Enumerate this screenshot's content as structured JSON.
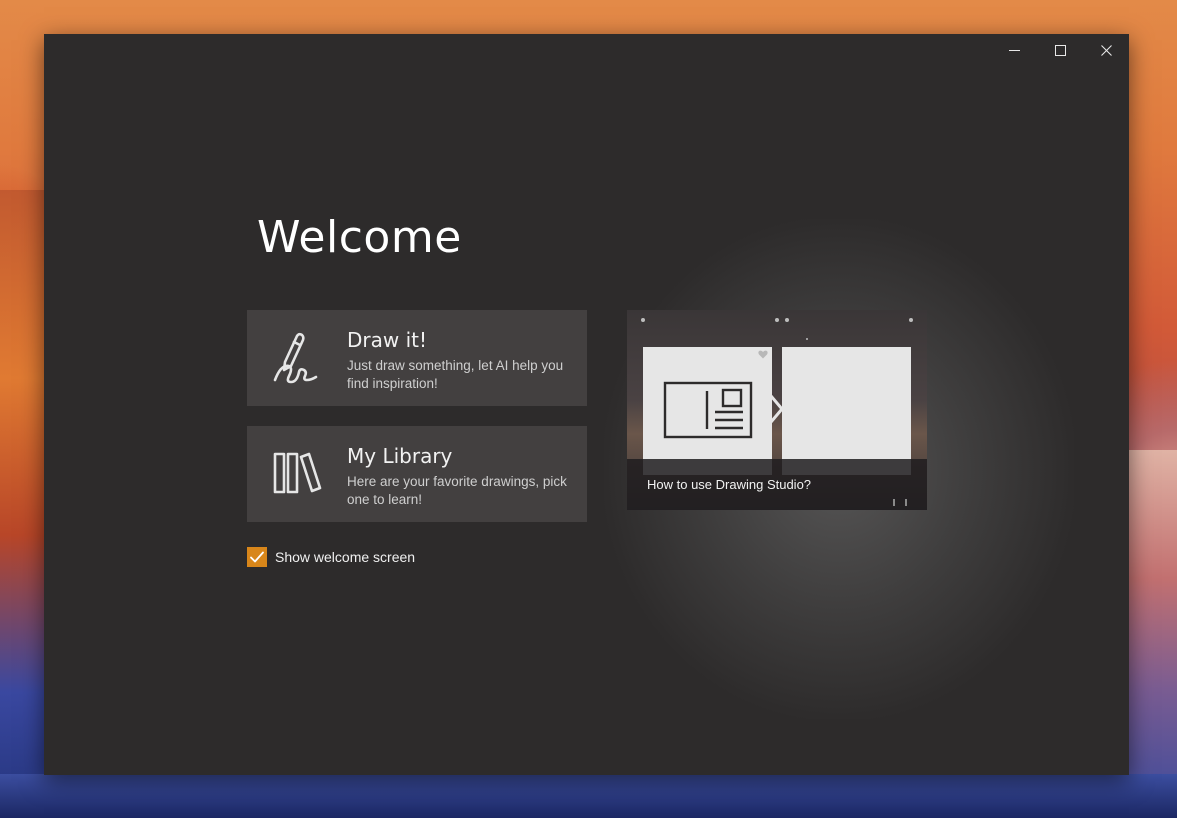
{
  "window": {
    "caption_buttons": {
      "minimize_icon": "minimize-icon",
      "maximize_icon": "maximize-icon",
      "close_icon": "close-icon"
    }
  },
  "welcome": {
    "title": "Welcome"
  },
  "tiles": [
    {
      "title": "Draw it!",
      "description": "Just draw something, let AI help you find inspiration!",
      "icon": "pen-scribble-icon"
    },
    {
      "title": "My Library",
      "description": "Here are your favorite drawings, pick one to learn!",
      "icon": "library-books-icon"
    }
  ],
  "show_welcome": {
    "label": "Show welcome screen",
    "checked": true,
    "accent": "#d8861a"
  },
  "video_card": {
    "caption": "How to use Drawing Studio?",
    "icon": "postcard-icon"
  },
  "colors": {
    "window_bg": "#2d2b2b",
    "tile_bg": "#434040",
    "accent": "#d8861a"
  }
}
